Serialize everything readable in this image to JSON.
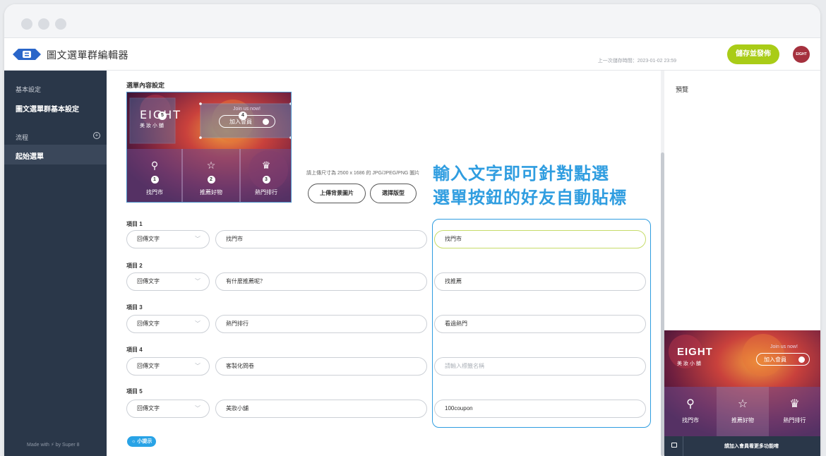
{
  "app": {
    "title": "圖文選單群編輯器",
    "last_saved": "上一次儲存時間：2023-01-02 23:59",
    "publish_label": "儲存並發佈",
    "avatar_text": "EIGHT"
  },
  "sidebar": {
    "section_basic": "基本設定",
    "item_basic": "圖文選單群基本設定",
    "section_flow": "流程",
    "item_start": "起始選單",
    "footer": "Made with ⚡ by Super 8"
  },
  "main": {
    "section_title": "選單內容設定",
    "upload_hint": "請上傳尺寸為 2500 x 1686 的 JPG/JPEG/PNG 圖片",
    "upload_bg_label": "上傳背景圖片",
    "choose_layout_label": "選擇版型",
    "callout_line1": "輸入文字即可針對點選",
    "callout_line2": "選單按鈕的好友自動貼標",
    "hint_badge": "☼ 小提示"
  },
  "menu_image": {
    "brand": "EIGHT",
    "brand_sub": "美 妝 小 舖",
    "join_now": "Join us now!",
    "join_label": "加入會員",
    "cells": [
      {
        "num": "1",
        "label": "找門市",
        "icon": "location-icon"
      },
      {
        "num": "2",
        "label": "推薦好物",
        "icon": "star-icon"
      },
      {
        "num": "3",
        "label": "熱門排行",
        "icon": "trophy-icon"
      }
    ],
    "area4_num": "4",
    "area5_num": "5"
  },
  "items": [
    {
      "label": "項目 1",
      "action": "回傳文字",
      "text": "找門市",
      "tag": "找門市",
      "tag_placeholder": false
    },
    {
      "label": "項目 2",
      "action": "回傳文字",
      "text": "有什麼推薦呢？",
      "tag": "找推薦",
      "tag_placeholder": false
    },
    {
      "label": "項目 3",
      "action": "回傳文字",
      "text": "熱門排行",
      "tag": "看過熱門",
      "tag_placeholder": false
    },
    {
      "label": "項目 4",
      "action": "回傳文字",
      "text": "客製化問卷",
      "tag": "請輸入標籤名稱",
      "tag_placeholder": true
    },
    {
      "label": "項目 5",
      "action": "回傳文字",
      "text": "美妝小舖",
      "tag": "100coupon",
      "tag_placeholder": false
    }
  ],
  "preview": {
    "title": "預覽",
    "brand": "EIGHT",
    "brand_sub": "美 妝 小 舖",
    "join_now": "Join us now!",
    "join_label": "加入會員",
    "cells": [
      "找門市",
      "推薦好物",
      "熱門排行"
    ],
    "bar_text": "請加入會員看更多功能唷"
  },
  "colors": {
    "accent_green": "#a9cc17",
    "accent_blue": "#2f9de0",
    "sidebar_bg": "#2a3749",
    "avatar_bg": "#a5313e"
  }
}
